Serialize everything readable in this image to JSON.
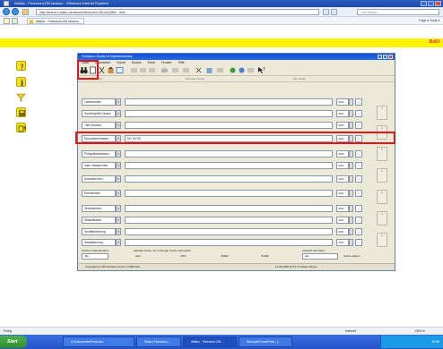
{
  "browser": {
    "window_title": "Wallux - Fenicsoro-DB session - Windows Internet Explorer",
    "address": "http://search1.wallux.de/session/fenicsoro-DB.do/(Z86e...html",
    "search_placeholder": "Live Search",
    "tab_label": "Wallux - Fenicsoro-DB session",
    "tools_text": "Page ▾  Tools ▾",
    "status_text": "Fertig",
    "zone_text": "Internet",
    "zoom_text": "100% ▾"
  },
  "header": {
    "brand": "BxDI"
  },
  "dialog": {
    "title": "Fenicsoro-Suche im Expertenmodus",
    "menu": [
      "Datei",
      "Bearbeiten",
      "Suche",
      "Modus",
      "Extra",
      "Fenster",
      "Hilfe"
    ],
    "modes": [
      "Einfache Suche",
      "Expertenmodus",
      "Alle Felder"
    ],
    "fields": [
      {
        "label": "Landesvoller",
        "value": "",
        "op": "UND"
      },
      {
        "label": "Suchbegriffe Deutsc",
        "value": "",
        "op": "UND"
      },
      {
        "label": "Titel Deutsch",
        "value": "",
        "op": "UND"
      },
      {
        "label": "Dokumentnummer",
        "value": "DE 19730",
        "op": "UND"
      },
      {
        "label": "Prüfgebietsklassen",
        "value": "",
        "op": "UND"
      },
      {
        "label": "Inter. Klassen/den",
        "value": "",
        "op": "UND"
      },
      {
        "label": "Anmelder/den",
        "value": "",
        "op": "UND"
      },
      {
        "label": "Erfinder/den",
        "value": "",
        "op": "UND"
      },
      {
        "label": "Vertreter/den",
        "value": "",
        "op": "UND"
      },
      {
        "label": "Klassifikation",
        "value": "",
        "op": "UND"
      },
      {
        "label": "Veröffentlichung",
        "value": "",
        "op": "UND"
      },
      {
        "label": "Aktualisierung",
        "value": "",
        "op": "UND"
      }
    ],
    "bottom": {
      "scope_label": "Suche in Datenbanken",
      "scope_value": "Alle",
      "result_label": "Aktuelle Suche mit vorheriger Suche verknüpfen",
      "radios": [
        "oder",
        "UND",
        "ODER",
        "OHNE"
      ],
      "count_label": "Auswahl der Daten",
      "count_value": "alle",
      "start_label": "Suche starten"
    },
    "status": {
      "left": "Copyright by DBI Software GmbH, 47008 DUI",
      "right": "11.06.2008  10:57:37  Status: Bereit"
    }
  },
  "taskbar": {
    "start": "Start",
    "tasks": [
      "C:\\Dokumente\\Fenicsoro",
      "Wallux Fenicsoro-...",
      "Wallux - Fenicsoro-DB ...",
      "Microsoft PowerPoint - [..."
    ],
    "clock": "10:58"
  }
}
